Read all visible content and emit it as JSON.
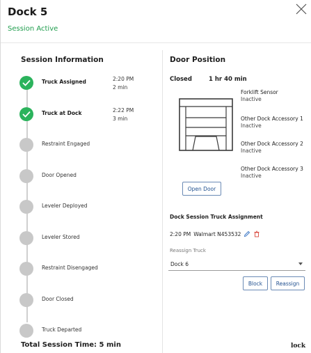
{
  "header": {
    "title": "Dock 5",
    "status": "Session Active",
    "status_color": "#1f9d4d"
  },
  "session": {
    "title": "Session Information",
    "steps": [
      {
        "label": "Truck Assigned",
        "time": "2:20 PM",
        "duration": "2 min",
        "done": true
      },
      {
        "label": "Truck at Dock",
        "time": "2:22 PM",
        "duration": "3 min",
        "done": true
      },
      {
        "label": "Restraint Engaged",
        "time": "",
        "duration": "",
        "done": false
      },
      {
        "label": "Door Opened",
        "time": "",
        "duration": "",
        "done": false
      },
      {
        "label": "Leveler Deployed",
        "time": "",
        "duration": "",
        "done": false
      },
      {
        "label": "Leveler Stored",
        "time": "",
        "duration": "",
        "done": false
      },
      {
        "label": "Restraint Disengaged",
        "time": "",
        "duration": "",
        "done": false
      },
      {
        "label": "Door Closed",
        "time": "",
        "duration": "",
        "done": false
      },
      {
        "label": "Truck Departed",
        "time": "",
        "duration": "",
        "done": false
      }
    ],
    "total_label": "Total Session Time:",
    "total_value": "5 min"
  },
  "door": {
    "title": "Door Position",
    "status": "Closed",
    "duration": "1 hr 40 min",
    "open_button": "Open Door",
    "accessories": [
      {
        "name": "Forklift Sensor",
        "state": "Inactive"
      },
      {
        "name": "Other Dock Accessory 1",
        "state": "Inactive"
      },
      {
        "name": "Other Dock Accessory 2",
        "state": "Inactive"
      },
      {
        "name": "Other Dock Accessory 3",
        "state": "Inactive"
      }
    ]
  },
  "assignment": {
    "title": "Dock Session Truck Assignment",
    "time": "2:20 PM",
    "truck": "Walmart N453532",
    "reassign_label": "Reassign Truck",
    "selected": "Dock 6",
    "block_button": "Block",
    "reassign_button": "Reassign"
  },
  "brand": {
    "logo_text": "ock",
    "logo_prefix": "l"
  },
  "colors": {
    "done": "#2bb35c",
    "pending": "#c8c8c8",
    "accent": "#1f4f8f"
  }
}
